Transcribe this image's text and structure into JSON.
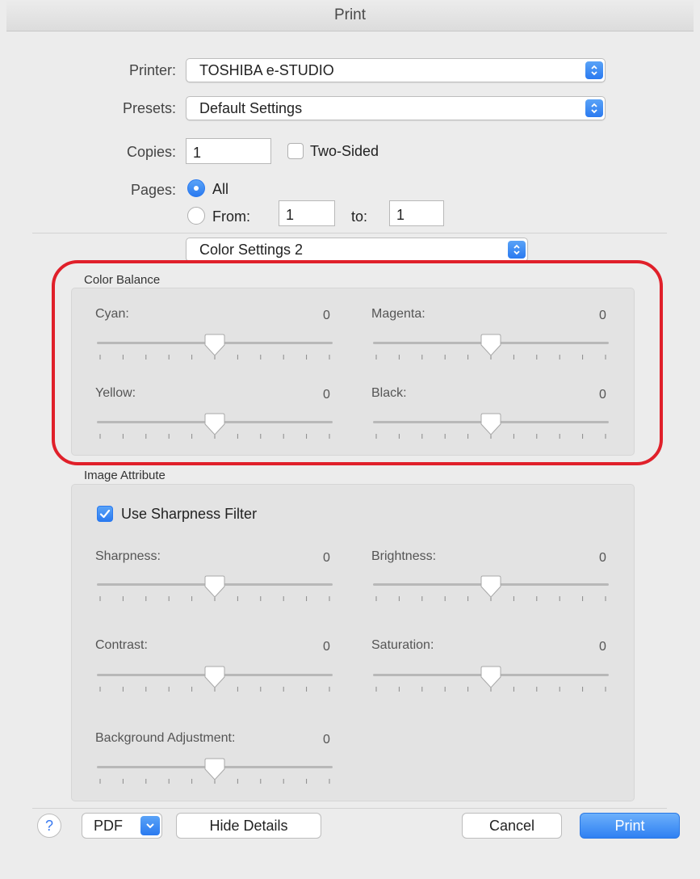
{
  "window": {
    "title": "Print"
  },
  "printer": {
    "label": "Printer:",
    "value": "TOSHIBA e-STUDIO"
  },
  "presets": {
    "label": "Presets:",
    "value": "Default Settings"
  },
  "copies": {
    "label": "Copies:",
    "value": "1",
    "two_sided_label": "Two-Sided",
    "two_sided_checked": false
  },
  "pages": {
    "label": "Pages:",
    "all_label": "All",
    "from_label": "From:",
    "from_value": "1",
    "to_label": "to:",
    "to_value": "1",
    "selected": "All"
  },
  "panel_select": {
    "value": "Color Settings 2"
  },
  "color_balance": {
    "title": "Color Balance",
    "sliders": [
      {
        "label": "Cyan:",
        "value": "0"
      },
      {
        "label": "Magenta:",
        "value": "0"
      },
      {
        "label": "Yellow:",
        "value": "0"
      },
      {
        "label": "Black:",
        "value": "0"
      }
    ]
  },
  "image_attribute": {
    "title": "Image Attribute",
    "sharpness_filter_label": "Use Sharpness Filter",
    "sharpness_filter_checked": true,
    "sliders": [
      {
        "label": "Sharpness:",
        "value": "0"
      },
      {
        "label": "Brightness:",
        "value": "0"
      },
      {
        "label": "Contrast:",
        "value": "0"
      },
      {
        "label": "Saturation:",
        "value": "0"
      },
      {
        "label": "Background Adjustment:",
        "value": "0"
      }
    ]
  },
  "footer": {
    "help_label": "?",
    "pdf_label": "PDF",
    "hide_details_label": "Hide Details",
    "cancel_label": "Cancel",
    "print_label": "Print"
  },
  "colors": {
    "accent": "#2f80f2",
    "highlight": "#e0202a",
    "panel": "#e3e3e3"
  },
  "icons": [
    "chevron-updown-icon",
    "chevron-down-icon",
    "checkmark-icon",
    "help-icon",
    "slider-thumb-icon"
  ]
}
